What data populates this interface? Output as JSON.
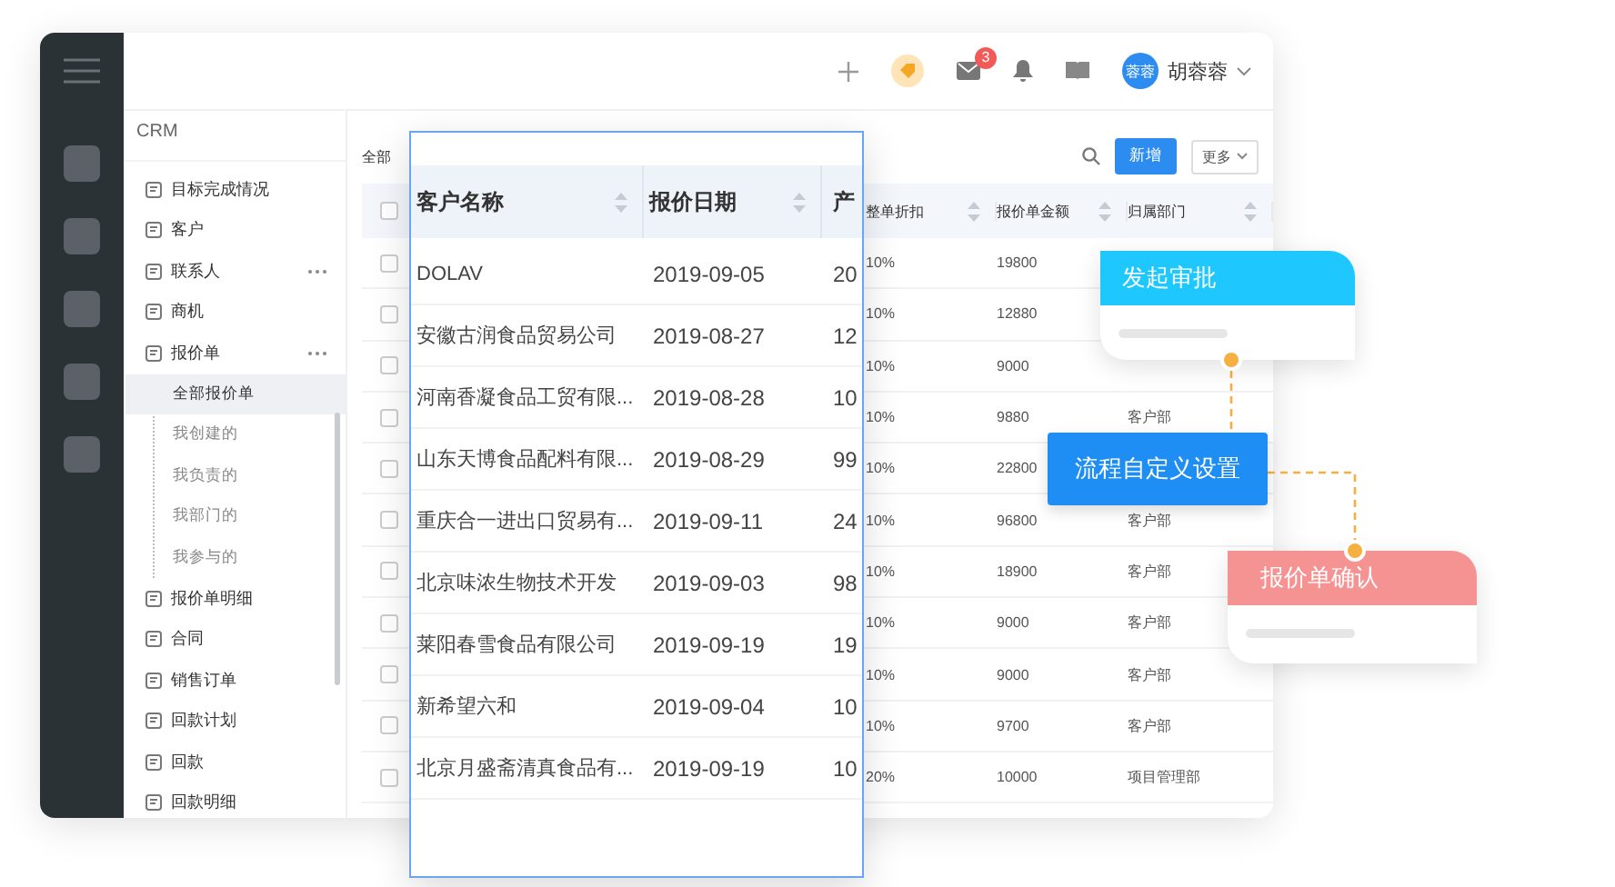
{
  "topbar": {
    "mail_badge": "3",
    "avatar": "蓉蓉",
    "user": "胡蓉蓉"
  },
  "nav": {
    "title": "CRM",
    "items": [
      {
        "label": "目标完成情况",
        "selected": false,
        "has_more": false
      },
      {
        "label": "客户",
        "selected": false,
        "has_more": false
      },
      {
        "label": "联系人",
        "selected": false,
        "has_more": true
      },
      {
        "label": "商机",
        "selected": false,
        "has_more": false
      },
      {
        "label": "报价单",
        "selected": false,
        "has_more": true,
        "expanded": true,
        "children": [
          {
            "label": "全部报价单",
            "selected": true
          },
          {
            "label": "我创建的",
            "selected": false
          },
          {
            "label": "我负责的",
            "selected": false
          },
          {
            "label": "我部门的",
            "selected": false
          },
          {
            "label": "我参与的",
            "selected": false
          }
        ]
      },
      {
        "label": "报价单明细",
        "selected": false,
        "has_more": false
      },
      {
        "label": "合同",
        "selected": false,
        "has_more": false
      },
      {
        "label": "销售订单",
        "selected": false,
        "has_more": false
      },
      {
        "label": "回款计划",
        "selected": false,
        "has_more": false
      },
      {
        "label": "回款",
        "selected": false,
        "has_more": false
      },
      {
        "label": "回款明细",
        "selected": false,
        "has_more": false
      }
    ]
  },
  "toolbar": {
    "filter": "全部",
    "add_button": "新增",
    "more_button": "更多"
  },
  "table": {
    "header_checked": false,
    "columns": [
      "整单折扣",
      "报价单金额",
      "归属部门"
    ],
    "rows": [
      {
        "checked": false,
        "discount": "10%",
        "amount": "19800"
      },
      {
        "checked": false,
        "discount": "10%",
        "amount": "12880"
      },
      {
        "checked": false,
        "discount": "10%",
        "amount": "9000"
      },
      {
        "checked": false,
        "discount": "10%",
        "amount": "9880",
        "dept": "客户部"
      },
      {
        "checked": false,
        "discount": "10%",
        "amount": "22800"
      },
      {
        "checked": false,
        "discount": "10%",
        "amount": "96800",
        "dept": "客户部"
      },
      {
        "checked": false,
        "discount": "10%",
        "amount": "18900",
        "dept": "客户部"
      },
      {
        "checked": false,
        "discount": "10%",
        "amount": "9000",
        "dept": "客户部"
      },
      {
        "checked": false,
        "discount": "10%",
        "amount": "9000",
        "dept": "客户部"
      },
      {
        "checked": false,
        "discount": "10%",
        "amount": "9700",
        "dept": "客户部"
      },
      {
        "checked": false,
        "discount": "20%",
        "amount": "10000",
        "dept": "项目管理部"
      }
    ]
  },
  "zoom_card": {
    "columns": [
      "客户名称",
      "报价日期",
      "产"
    ],
    "rows": [
      {
        "customer": "DOLAV",
        "date": "2019-09-05",
        "product": "20"
      },
      {
        "customer": "安徽古润食品贸易公司",
        "date": "2019-08-27",
        "product": "12"
      },
      {
        "customer": "河南香凝食品工贸有限...",
        "date": "2019-08-28",
        "product": "10"
      },
      {
        "customer": "山东天博食品配料有限...",
        "date": "2019-08-29",
        "product": "99"
      },
      {
        "customer": "重庆合一进出口贸易有...",
        "date": "2019-09-11",
        "product": "24"
      },
      {
        "customer": "北京味浓生物技术开发",
        "date": "2019-09-03",
        "product": "98"
      },
      {
        "customer": "莱阳春雪食品有限公司",
        "date": "2019-09-19",
        "product": "19"
      },
      {
        "customer": "新希望六和",
        "date": "2019-09-04",
        "product": "10"
      },
      {
        "customer": "北京月盛斋清真食品有...",
        "date": "2019-09-19",
        "product": "10"
      }
    ]
  },
  "flow": {
    "start": "发起审批",
    "center": "流程自定义设置",
    "end": "报价单确认"
  }
}
